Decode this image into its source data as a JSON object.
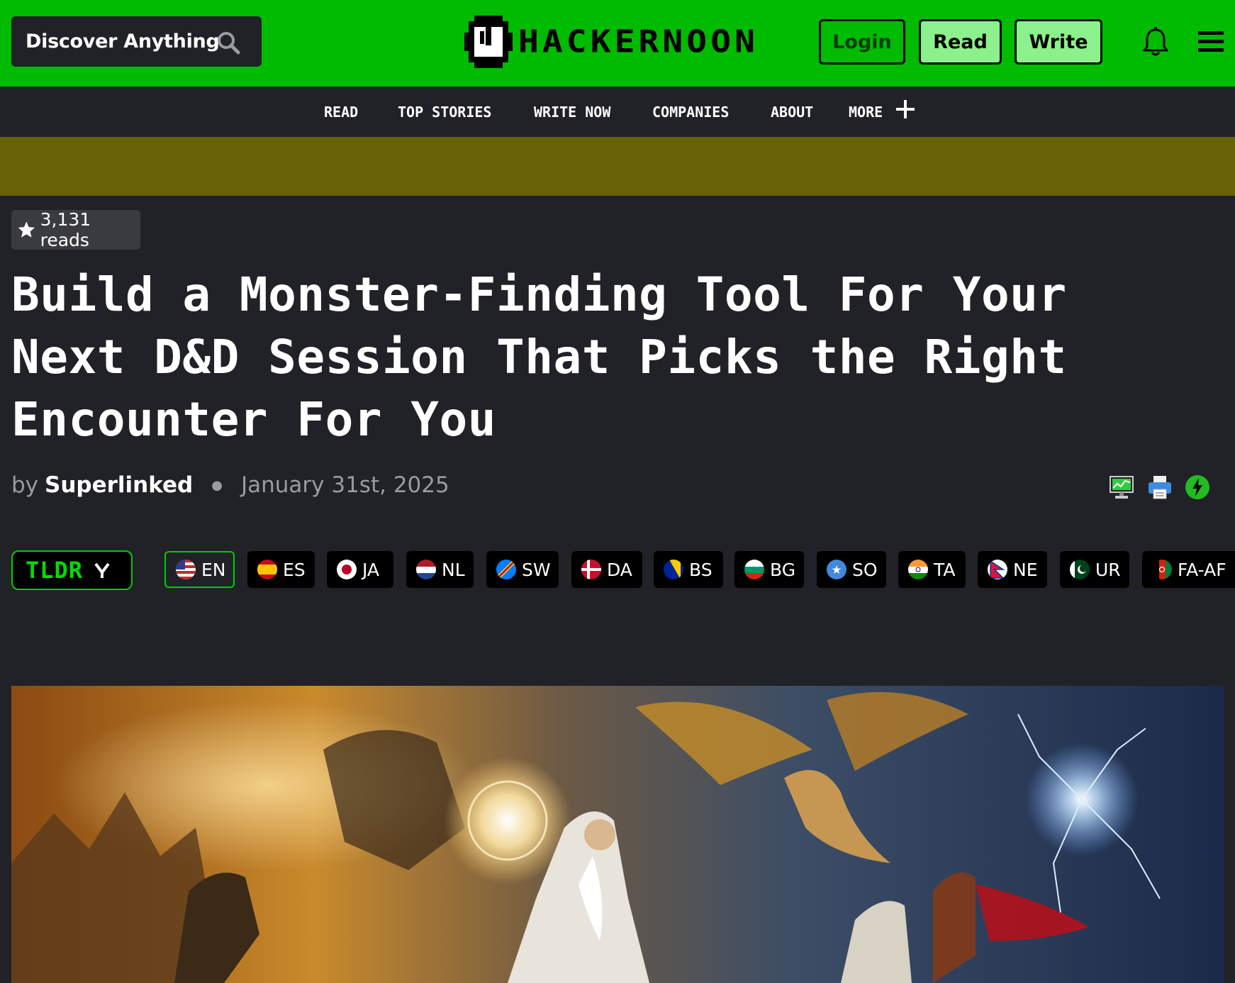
{
  "header": {
    "search_label": "Discover Anything",
    "logo_text": "HACKERNOON",
    "login_label": "Login",
    "read_label": "Read",
    "write_label": "Write",
    "bell_icon": "bell-icon",
    "menu_icon": "hamburger-menu-icon",
    "brand_color": "#00bb00"
  },
  "nav": {
    "items": [
      "READ",
      "TOP STORIES",
      "WRITE NOW",
      "COMPANIES",
      "ABOUT",
      "MORE"
    ]
  },
  "article": {
    "reads": "3,131 reads",
    "title": "Build a Monster-Finding Tool For Your Next D&D Session That Picks the Right Encounter For You",
    "by": "by",
    "author": "Superlinked",
    "date": "January 31st, 2025"
  },
  "tools": [
    "monitor-icon",
    "printer-icon",
    "power-icon"
  ],
  "tldr_label": "TLDR",
  "languages": [
    "EN",
    "ES",
    "JA",
    "NL",
    "SW",
    "DA",
    "BS",
    "BG",
    "SO",
    "TA",
    "NE",
    "UR",
    "FA-AF"
  ]
}
